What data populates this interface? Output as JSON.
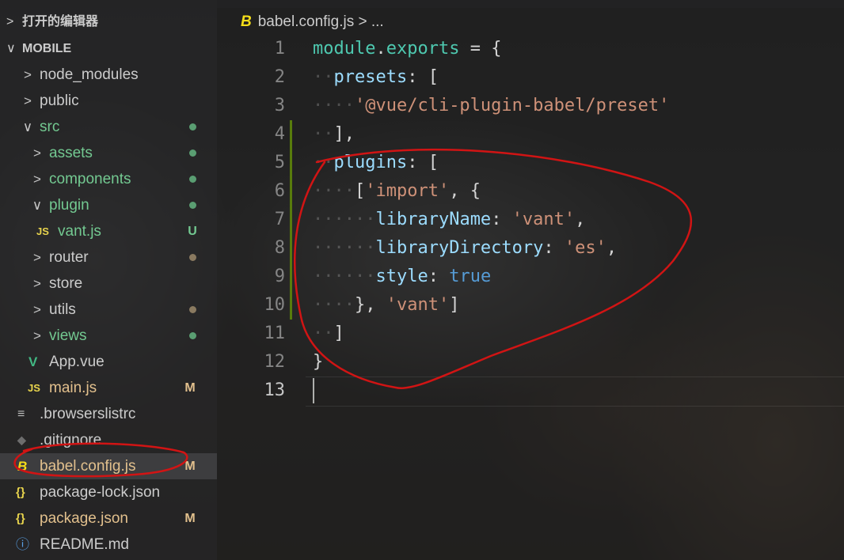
{
  "sidebar": {
    "open_editors": {
      "chevron": ">",
      "label": "打开的编辑器"
    },
    "project": {
      "chevron": "∨",
      "label": "MOBILE"
    },
    "items": [
      {
        "label": "node_modules",
        "chevron": ">",
        "status": "",
        "color": "#cccccc"
      },
      {
        "label": "public",
        "chevron": ">",
        "status": "",
        "color": "#cccccc"
      },
      {
        "label": "src",
        "chevron": "∨",
        "status": "dot",
        "color": "#73c991"
      },
      {
        "label": "assets",
        "chevron": ">",
        "status": "dot",
        "color": "#73c991"
      },
      {
        "label": "components",
        "chevron": ">",
        "status": "dot",
        "color": "#73c991"
      },
      {
        "label": "plugin",
        "chevron": "∨",
        "status": "dot",
        "color": "#73c991"
      },
      {
        "label": "vant.js",
        "icon": "JS",
        "status": "U",
        "color": "#73c991"
      },
      {
        "label": "router",
        "chevron": ">",
        "status": "dot",
        "color": "#cccccc"
      },
      {
        "label": "store",
        "chevron": ">",
        "status": "",
        "color": "#cccccc"
      },
      {
        "label": "utils",
        "chevron": ">",
        "status": "dot",
        "color": "#cccccc"
      },
      {
        "label": "views",
        "chevron": ">",
        "status": "dot",
        "color": "#73c991"
      },
      {
        "label": "App.vue",
        "icon": "V",
        "status": "",
        "color": "#cccccc"
      },
      {
        "label": "main.js",
        "icon": "JS",
        "status": "M",
        "color": "#e2c08d"
      },
      {
        "label": ".browserslistrc",
        "icon": "≡",
        "status": "",
        "color": "#cccccc"
      },
      {
        "label": ".gitignore",
        "icon": "◆",
        "status": "",
        "color": "#cccccc"
      },
      {
        "label": "babel.config.js",
        "icon": "B",
        "status": "M",
        "color": "#e2c08d"
      },
      {
        "label": "package-lock.json",
        "icon": "{}",
        "status": "",
        "color": "#cccccc"
      },
      {
        "label": "package.json",
        "icon": "{}",
        "status": "M",
        "color": "#e2c08d"
      },
      {
        "label": "README.md",
        "icon": "ⓘ",
        "status": "",
        "color": "#cccccc"
      }
    ]
  },
  "editor": {
    "breadcrumb": {
      "icon": "B",
      "file": "babel.config.js",
      "sep": ">",
      "more": "..."
    },
    "line_numbers": [
      "1",
      "2",
      "3",
      "4",
      "5",
      "6",
      "7",
      "8",
      "9",
      "10",
      "11",
      "12",
      "13"
    ],
    "code": {
      "l1": {
        "a": "module",
        "b": ".",
        "c": "exports",
        "d": " = {"
      },
      "l2": {
        "a": "presets",
        "b": ": ["
      },
      "l3": {
        "a": "'@vue/cli-plugin-babel/preset'"
      },
      "l4": {
        "a": "],"
      },
      "l5": {
        "a": "plugins",
        "b": ": ["
      },
      "l6": {
        "a": "[",
        "b": "'import'",
        "c": ", {"
      },
      "l7": {
        "a": "libraryName",
        "b": ": ",
        "c": "'vant'",
        "d": ","
      },
      "l8": {
        "a": "libraryDirectory",
        "b": ": ",
        "c": "'es'",
        "d": ","
      },
      "l9": {
        "a": "style",
        "b": ": ",
        "c": "true"
      },
      "l10": {
        "a": "}, ",
        "b": "'vant'",
        "c": "]"
      },
      "l11": {
        "a": "]"
      },
      "l12": {
        "a": "}"
      }
    }
  },
  "colors": {
    "annotation": "#d11414",
    "git_added": "#73c991",
    "git_modified": "#e2c08d",
    "gutter_change": "#587c0c"
  }
}
